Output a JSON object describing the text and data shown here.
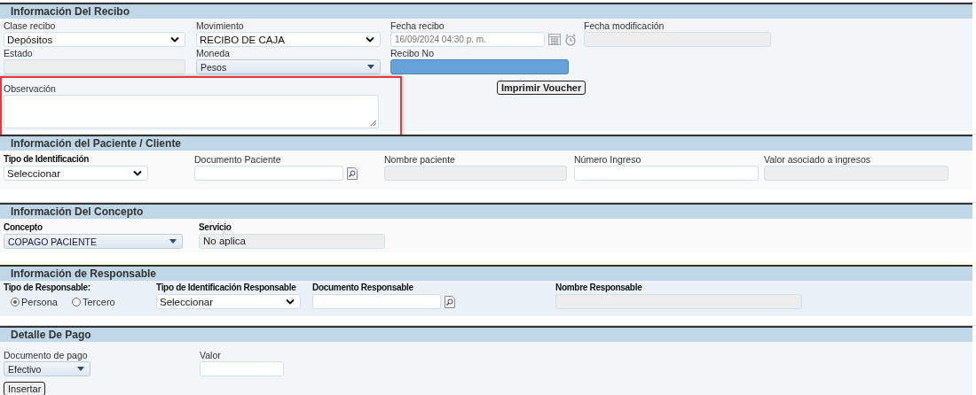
{
  "sections": [
    {
      "title": "Información Del Recibo",
      "rows": [
        {
          "fields": [
            {
              "label": "Clase recibo",
              "kind": "select",
              "value": "Depósitos",
              "bold": false
            },
            {
              "label": "Movimiento",
              "kind": "select",
              "value": "RECIBO DE CAJA",
              "bold": false
            },
            {
              "label": "Fecha recibo",
              "kind": "date",
              "value": "16/09/2024 04:30 p. m.",
              "bold": false
            },
            {
              "label": "Fecha modificación",
              "kind": "readonly",
              "bold": false
            }
          ]
        },
        {
          "fields": [
            {
              "label": "Estado",
              "kind": "readonly",
              "bold": false
            },
            {
              "label": "Moneda",
              "kind": "combo",
              "value": "Pesos",
              "bold": false
            },
            {
              "label": "Recibo No",
              "kind": "filled",
              "bold": false
            }
          ]
        },
        {
          "fields": [
            {
              "label": "Observación",
              "kind": "textarea",
              "bold": false,
              "highlighted": true
            },
            {
              "kind": "button",
              "label": "Imprimir Voucher"
            }
          ]
        }
      ]
    },
    {
      "title": "Información del Paciente / Cliente",
      "rows": [
        {
          "fields": [
            {
              "label": "Tipo de Identificación",
              "kind": "select",
              "value": "Seleccionar",
              "bold": true
            },
            {
              "label": "Documento Paciente",
              "kind": "lookup",
              "bold": false
            },
            {
              "label": "Nombre paciente",
              "kind": "readonly",
              "bold": false
            },
            {
              "label": "Número Ingreso",
              "kind": "input",
              "bold": false
            },
            {
              "label": "Valor asociado a ingresos",
              "kind": "readonly",
              "bold": false
            }
          ]
        }
      ]
    },
    {
      "title": "Información Del Concepto",
      "rows": [
        {
          "fields": [
            {
              "label": "Concepto",
              "kind": "combo",
              "value": "COPAGO PACIENTE",
              "bold": true
            },
            {
              "label": "Servicio",
              "kind": "readonly",
              "value": "No aplica",
              "bold": true
            }
          ]
        }
      ]
    },
    {
      "title": "Información de Responsable",
      "rows": [
        {
          "fields": [
            {
              "label": "Tipo de Responsable:",
              "kind": "radios",
              "bold": true,
              "options": [
                {
                  "label": "Persona",
                  "selected": true
                },
                {
                  "label": "Tercero",
                  "selected": false
                }
              ]
            },
            {
              "label": "Tipo de Identificación Responsable",
              "kind": "select",
              "value": "Seleccionar",
              "bold": true
            },
            {
              "label": "Documento Responsable",
              "kind": "lookup",
              "bold": true
            },
            {
              "label": "Nombre Responsable",
              "kind": "readonly",
              "bold": true
            }
          ]
        }
      ]
    },
    {
      "title": "Detalle De Pago",
      "rows": [
        {
          "fields": [
            {
              "label": "Documento de pago",
              "kind": "combo",
              "value": "Efectivo",
              "bold": false
            },
            {
              "label": "Valor",
              "kind": "input",
              "bold": false
            }
          ]
        },
        {
          "fields": [
            {
              "kind": "button",
              "label": "Insertar"
            }
          ]
        }
      ]
    }
  ]
}
